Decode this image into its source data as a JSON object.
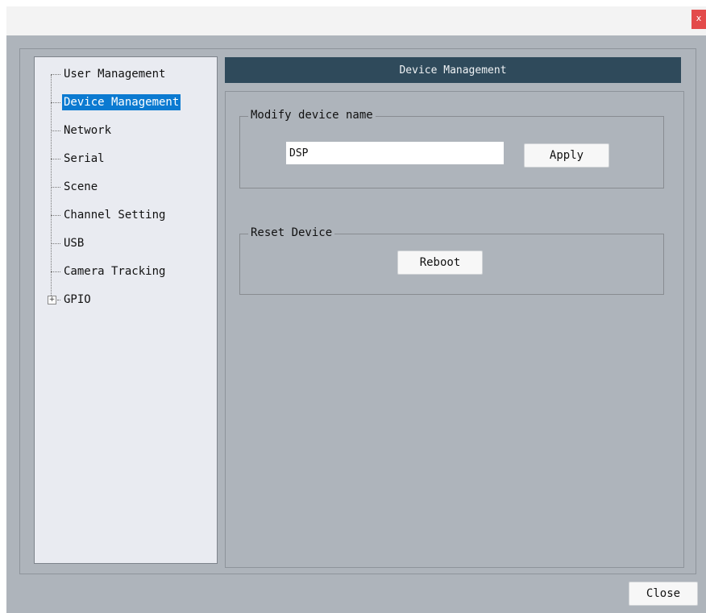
{
  "window": {
    "close_glyph": "x"
  },
  "nav": {
    "items": [
      {
        "label": "User Management"
      },
      {
        "label": "Device Management",
        "selected": true
      },
      {
        "label": "Network"
      },
      {
        "label": "Serial"
      },
      {
        "label": "Scene"
      },
      {
        "label": "Channel Setting"
      },
      {
        "label": "USB"
      },
      {
        "label": "Camera Tracking"
      },
      {
        "label": "GPIO",
        "expandable": true,
        "expander": "+"
      }
    ]
  },
  "panel": {
    "title": "Device Management",
    "modify_group": {
      "legend": "Modify device name",
      "device_name_value": "DSP",
      "apply_label": "Apply"
    },
    "reset_group": {
      "legend": "Reset Device",
      "reboot_label": "Reboot"
    }
  },
  "footer": {
    "close_label": "Close"
  },
  "colors": {
    "header_bg": "#2f4a5b",
    "selected_bg": "#0b7ad1",
    "window_bg": "#aeb4bb",
    "close_x_bg": "#e34b4b"
  }
}
